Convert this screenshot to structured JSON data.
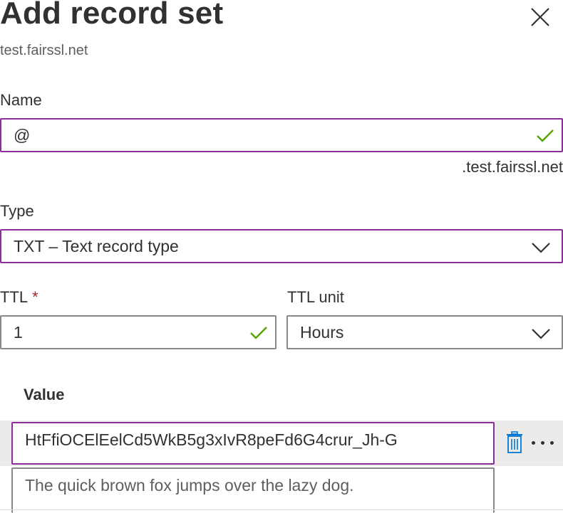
{
  "header": {
    "title": "Add record set",
    "subtitle": "test.fairssl.net",
    "close_icon": "close-icon"
  },
  "name_field": {
    "label": "Name",
    "value": "@",
    "suffix": ".test.fairssl.net",
    "valid": true
  },
  "type_field": {
    "label": "Type",
    "value": "TXT – Text record type"
  },
  "ttl_field": {
    "label": "TTL",
    "required_marker": "*",
    "value": "1",
    "valid": true
  },
  "ttl_unit_field": {
    "label": "TTL unit",
    "value": "Hours"
  },
  "value_section": {
    "header": "Value",
    "rows": [
      {
        "value": "HtFfiOCElEelCd5WkB5g3xIvR8peFd6G4crur_Jh-G"
      }
    ],
    "new_row_value": "The quick brown fox jumps over the lazy dog."
  },
  "colors": {
    "focus_border": "#8c2d9b",
    "valid_check": "#57a300",
    "delete_icon": "#0078d4",
    "required": "#a4262c"
  }
}
